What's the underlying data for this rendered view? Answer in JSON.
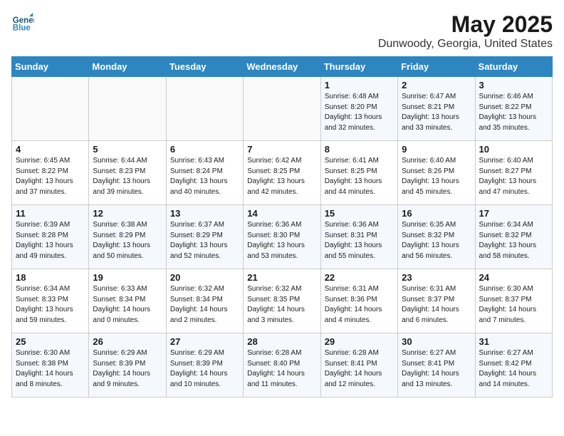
{
  "logo": {
    "line1": "General",
    "line2": "Blue"
  },
  "header": {
    "month": "May 2025",
    "location": "Dunwoody, Georgia, United States"
  },
  "weekdays": [
    "Sunday",
    "Monday",
    "Tuesday",
    "Wednesday",
    "Thursday",
    "Friday",
    "Saturday"
  ],
  "weeks": [
    [
      {
        "day": "",
        "info": ""
      },
      {
        "day": "",
        "info": ""
      },
      {
        "day": "",
        "info": ""
      },
      {
        "day": "",
        "info": ""
      },
      {
        "day": "1",
        "info": "Sunrise: 6:48 AM\nSunset: 8:20 PM\nDaylight: 13 hours\nand 32 minutes."
      },
      {
        "day": "2",
        "info": "Sunrise: 6:47 AM\nSunset: 8:21 PM\nDaylight: 13 hours\nand 33 minutes."
      },
      {
        "day": "3",
        "info": "Sunrise: 6:46 AM\nSunset: 8:22 PM\nDaylight: 13 hours\nand 35 minutes."
      }
    ],
    [
      {
        "day": "4",
        "info": "Sunrise: 6:45 AM\nSunset: 8:22 PM\nDaylight: 13 hours\nand 37 minutes."
      },
      {
        "day": "5",
        "info": "Sunrise: 6:44 AM\nSunset: 8:23 PM\nDaylight: 13 hours\nand 39 minutes."
      },
      {
        "day": "6",
        "info": "Sunrise: 6:43 AM\nSunset: 8:24 PM\nDaylight: 13 hours\nand 40 minutes."
      },
      {
        "day": "7",
        "info": "Sunrise: 6:42 AM\nSunset: 8:25 PM\nDaylight: 13 hours\nand 42 minutes."
      },
      {
        "day": "8",
        "info": "Sunrise: 6:41 AM\nSunset: 8:25 PM\nDaylight: 13 hours\nand 44 minutes."
      },
      {
        "day": "9",
        "info": "Sunrise: 6:40 AM\nSunset: 8:26 PM\nDaylight: 13 hours\nand 45 minutes."
      },
      {
        "day": "10",
        "info": "Sunrise: 6:40 AM\nSunset: 8:27 PM\nDaylight: 13 hours\nand 47 minutes."
      }
    ],
    [
      {
        "day": "11",
        "info": "Sunrise: 6:39 AM\nSunset: 8:28 PM\nDaylight: 13 hours\nand 49 minutes."
      },
      {
        "day": "12",
        "info": "Sunrise: 6:38 AM\nSunset: 8:29 PM\nDaylight: 13 hours\nand 50 minutes."
      },
      {
        "day": "13",
        "info": "Sunrise: 6:37 AM\nSunset: 8:29 PM\nDaylight: 13 hours\nand 52 minutes."
      },
      {
        "day": "14",
        "info": "Sunrise: 6:36 AM\nSunset: 8:30 PM\nDaylight: 13 hours\nand 53 minutes."
      },
      {
        "day": "15",
        "info": "Sunrise: 6:36 AM\nSunset: 8:31 PM\nDaylight: 13 hours\nand 55 minutes."
      },
      {
        "day": "16",
        "info": "Sunrise: 6:35 AM\nSunset: 8:32 PM\nDaylight: 13 hours\nand 56 minutes."
      },
      {
        "day": "17",
        "info": "Sunrise: 6:34 AM\nSunset: 8:32 PM\nDaylight: 13 hours\nand 58 minutes."
      }
    ],
    [
      {
        "day": "18",
        "info": "Sunrise: 6:34 AM\nSunset: 8:33 PM\nDaylight: 13 hours\nand 59 minutes."
      },
      {
        "day": "19",
        "info": "Sunrise: 6:33 AM\nSunset: 8:34 PM\nDaylight: 14 hours\nand 0 minutes."
      },
      {
        "day": "20",
        "info": "Sunrise: 6:32 AM\nSunset: 8:34 PM\nDaylight: 14 hours\nand 2 minutes."
      },
      {
        "day": "21",
        "info": "Sunrise: 6:32 AM\nSunset: 8:35 PM\nDaylight: 14 hours\nand 3 minutes."
      },
      {
        "day": "22",
        "info": "Sunrise: 6:31 AM\nSunset: 8:36 PM\nDaylight: 14 hours\nand 4 minutes."
      },
      {
        "day": "23",
        "info": "Sunrise: 6:31 AM\nSunset: 8:37 PM\nDaylight: 14 hours\nand 6 minutes."
      },
      {
        "day": "24",
        "info": "Sunrise: 6:30 AM\nSunset: 8:37 PM\nDaylight: 14 hours\nand 7 minutes."
      }
    ],
    [
      {
        "day": "25",
        "info": "Sunrise: 6:30 AM\nSunset: 8:38 PM\nDaylight: 14 hours\nand 8 minutes."
      },
      {
        "day": "26",
        "info": "Sunrise: 6:29 AM\nSunset: 8:39 PM\nDaylight: 14 hours\nand 9 minutes."
      },
      {
        "day": "27",
        "info": "Sunrise: 6:29 AM\nSunset: 8:39 PM\nDaylight: 14 hours\nand 10 minutes."
      },
      {
        "day": "28",
        "info": "Sunrise: 6:28 AM\nSunset: 8:40 PM\nDaylight: 14 hours\nand 11 minutes."
      },
      {
        "day": "29",
        "info": "Sunrise: 6:28 AM\nSunset: 8:41 PM\nDaylight: 14 hours\nand 12 minutes."
      },
      {
        "day": "30",
        "info": "Sunrise: 6:27 AM\nSunset: 8:41 PM\nDaylight: 14 hours\nand 13 minutes."
      },
      {
        "day": "31",
        "info": "Sunrise: 6:27 AM\nSunset: 8:42 PM\nDaylight: 14 hours\nand 14 minutes."
      }
    ]
  ]
}
